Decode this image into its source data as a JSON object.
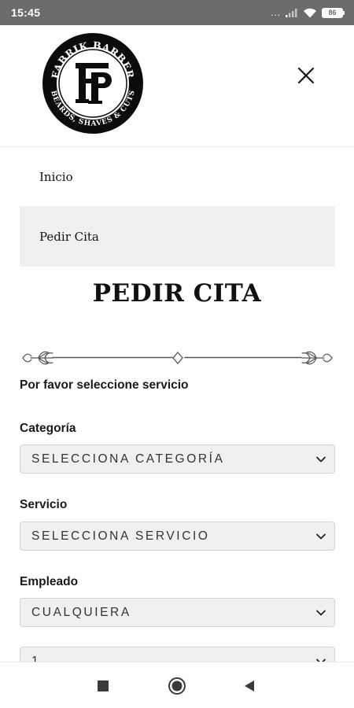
{
  "status_bar": {
    "time": "15:45",
    "signal_dots": "...",
    "battery_level": "86"
  },
  "header": {
    "logo": {
      "top_text": "FABRIK BARBER",
      "bottom_text": "BEARDS, SHAVES & CUTS",
      "monogram": "FB"
    },
    "close_icon": "close-icon"
  },
  "menu": {
    "items": [
      {
        "label": "Inicio",
        "active": false
      },
      {
        "label": "Pedir Cita",
        "active": true
      }
    ]
  },
  "page": {
    "title": "PEDIR CITA"
  },
  "form": {
    "intro": "Por favor seleccione servicio",
    "fields": [
      {
        "label": "Categoría",
        "value": "SELECCIONA CATEGORÍA"
      },
      {
        "label": "Servicio",
        "value": "SELECCIONA SERVICIO"
      },
      {
        "label": "Empleado",
        "value": "CUALQUIERA"
      },
      {
        "label": "",
        "value": "1"
      }
    ]
  },
  "nav_bar": {
    "icons": [
      "square-icon",
      "circle-icon",
      "triangle-back-icon"
    ]
  },
  "colors": {
    "status_bar": "#6b6b6b",
    "active_menu_bg": "#f0f0f0",
    "select_bg": "#f0f0f0",
    "text": "#111111"
  }
}
